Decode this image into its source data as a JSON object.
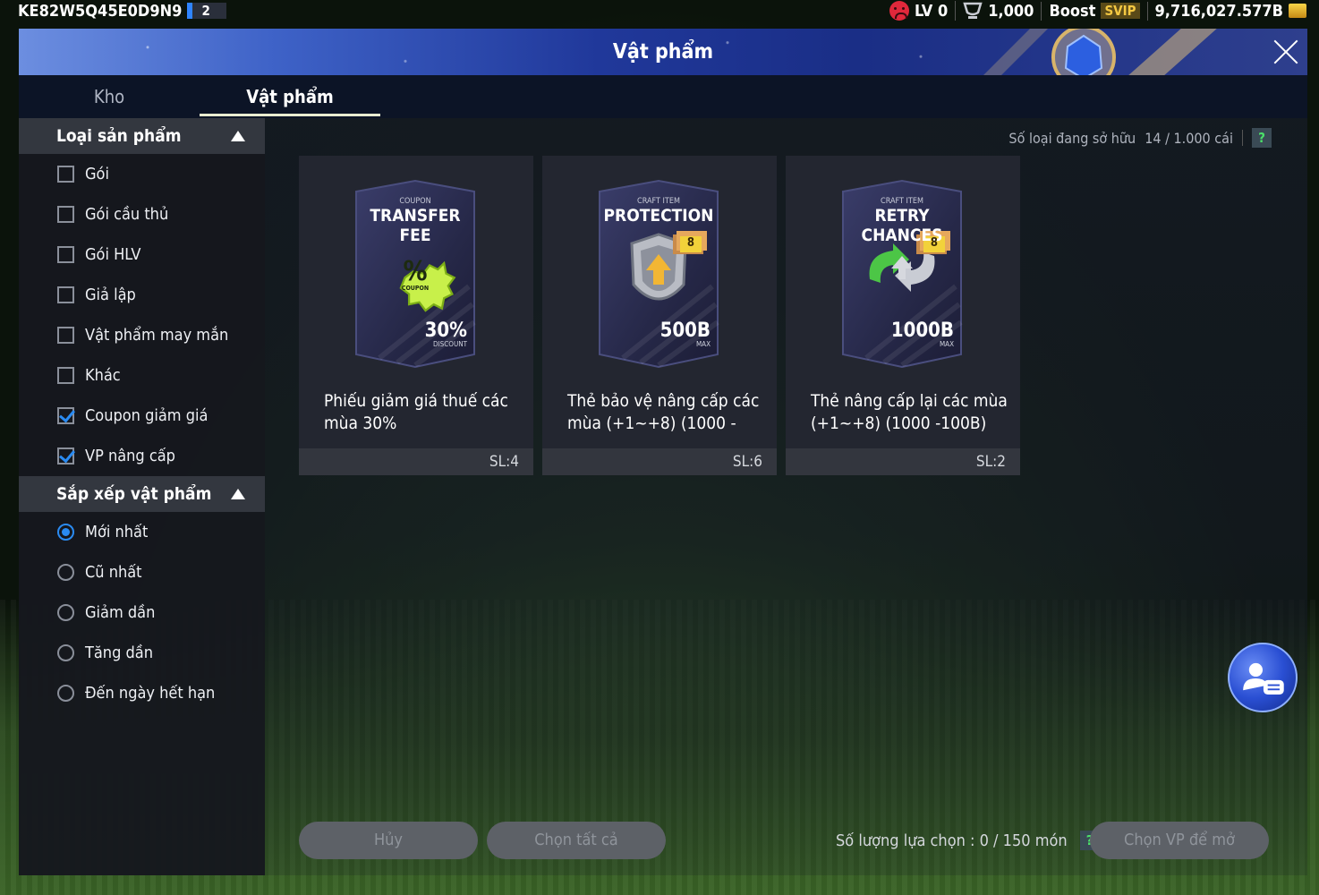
{
  "topbar": {
    "player_code": "KE82W5Q45E0D9N9",
    "slot_number": "2",
    "level": "LV 0",
    "trophy_count": "1,000",
    "boost_label": "Boost",
    "svip_label": "SVIP",
    "balance": "9,716,027.577B"
  },
  "window": {
    "title": "Vật phẩm",
    "tabs": [
      {
        "label": "Kho"
      },
      {
        "label": "Vật phẩm"
      }
    ]
  },
  "sidebar": {
    "product_section": {
      "title": "Loại sản phẩm",
      "options": [
        {
          "label": "Gói",
          "checked": false
        },
        {
          "label": "Gói cầu thủ",
          "checked": false
        },
        {
          "label": "Gói HLV",
          "checked": false
        },
        {
          "label": "Giả lập",
          "checked": false
        },
        {
          "label": "Vật phẩm may mắn",
          "checked": false
        },
        {
          "label": "Khác",
          "checked": false
        },
        {
          "label": "Coupon giảm giá",
          "checked": true
        },
        {
          "label": "VP nâng cấp",
          "checked": true
        }
      ]
    },
    "sort_section": {
      "title": "Sắp xếp vật phẩm",
      "options": [
        {
          "label": "Mới nhất",
          "selected": true
        },
        {
          "label": "Cũ nhất",
          "selected": false
        },
        {
          "label": "Giảm dần",
          "selected": false
        },
        {
          "label": "Tăng dần",
          "selected": false
        },
        {
          "label": "Đến ngày hết hạn",
          "selected": false
        }
      ]
    }
  },
  "content": {
    "owned_label": "Số loại đang sở hữu",
    "owned_value": "14 / 1.000 cái",
    "help_symbol": "?",
    "items": [
      {
        "small_caption": "COUPON",
        "big_caption": "TRANSFER FEE",
        "badge_text": "%",
        "badge_sub": "COUPON",
        "value_text": "30%",
        "value_sub": "DISCOUNT",
        "name": "Phiếu giảm giá thuế các mùa 30%",
        "quantity": "SL:4"
      },
      {
        "small_caption": "CRAFT ITEM",
        "big_caption": "PROTECTION",
        "badge_text": "8",
        "value_text": "500B",
        "value_sub": "MAX",
        "name": "Thẻ bảo vệ nâng cấp các mùa (+1~+8) (1000 -",
        "quantity": "SL:6"
      },
      {
        "small_caption": "CRAFT ITEM",
        "big_caption": "RETRY CHANCES",
        "badge_text": "8",
        "value_text": "1000B",
        "value_sub": "MAX",
        "name": "Thẻ nâng cấp lại các mùa (+1~+8) (1000 -100B)",
        "quantity": "SL:2"
      }
    ],
    "buttons": {
      "cancel": "Hủy",
      "select_all": "Chọn tất cả",
      "open_selected": "Chọn VP để mở"
    },
    "selection_label": "Số lượng lựa chọn : 0 / 150 món"
  },
  "colors": {
    "accent_blue": "#2a8bf2",
    "title_blue": "#20389a",
    "help_green": "#4be06a",
    "svip_gold": "#f4c842"
  },
  "icons": {
    "level": "sad-face-icon",
    "trophy": "trophy-icon",
    "currency": "coin-stack-icon",
    "close": "close-icon",
    "chat": "chat-support-icon"
  }
}
